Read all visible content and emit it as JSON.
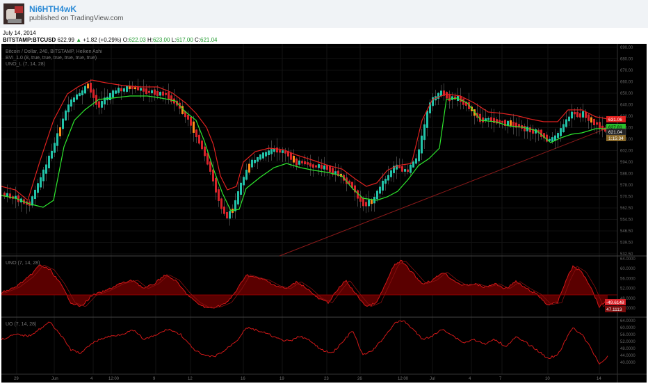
{
  "header": {
    "author": "Ni6HTH4wK",
    "published": "published on TradingView.com"
  },
  "info": {
    "date": "July 14, 2014",
    "symbol": "BITSTAMP:BTCUSD",
    "price": "622.99",
    "change": "+1.82 (+0.29%)",
    "o_label": "O:",
    "o": "622.03",
    "h_label": "H:",
    "h": "623.00",
    "l_label": "L:",
    "l": "617.00",
    "c_label": "C:",
    "c": "621.04"
  },
  "main_pane": {
    "title": "Bitcoin / Dollar, 240, BITSTAMP, Heiken Ashi",
    "study1": "BVI_1.0 (8, true, true, true, true, true, true)",
    "study2": "UNO_L (7, 14, 28)",
    "y_ticks": [
      "690.00",
      "680.00",
      "670.00",
      "660.00",
      "650.00",
      "640.00",
      "630.00",
      "620.00",
      "610.00",
      "602.00",
      "594.00",
      "586.00",
      "578.00",
      "570.50",
      "562.50",
      "554.50",
      "546.50",
      "539.50",
      "532.50"
    ],
    "badges": [
      "631.06",
      "627.81",
      "621.04",
      "1:15:34"
    ]
  },
  "uno_pane": {
    "title": "UNO (7, 14, 28)",
    "y_ticks": [
      "64.0000",
      "60.0000",
      "56.0000",
      "52.0000",
      "48.0000",
      "44.0000"
    ],
    "badges": [
      "-49.6148",
      "47.1113"
    ]
  },
  "uo_pane": {
    "title": "UO (7, 14, 28)",
    "y_ticks": [
      "64.0000",
      "60.0000",
      "56.0000",
      "52.0000",
      "48.0000",
      "44.0000",
      "40.0000"
    ]
  },
  "x_axis": {
    "labels": [
      "29",
      "Jun",
      "4",
      "12:00",
      "9",
      "12",
      "16",
      "19",
      "23",
      "26",
      "12:00",
      "Jul",
      "4",
      "7",
      "10",
      "14"
    ]
  },
  "colors": {
    "background": "#000000",
    "candle_up": "#22c3a8",
    "candle_down": "#d8232a",
    "candle_orange": "#ff8c1a",
    "upper_band": "#e0211f",
    "lower_band": "#2ee82e",
    "trendline": "#8b1a1a",
    "oscillator": "#d01818"
  }
}
